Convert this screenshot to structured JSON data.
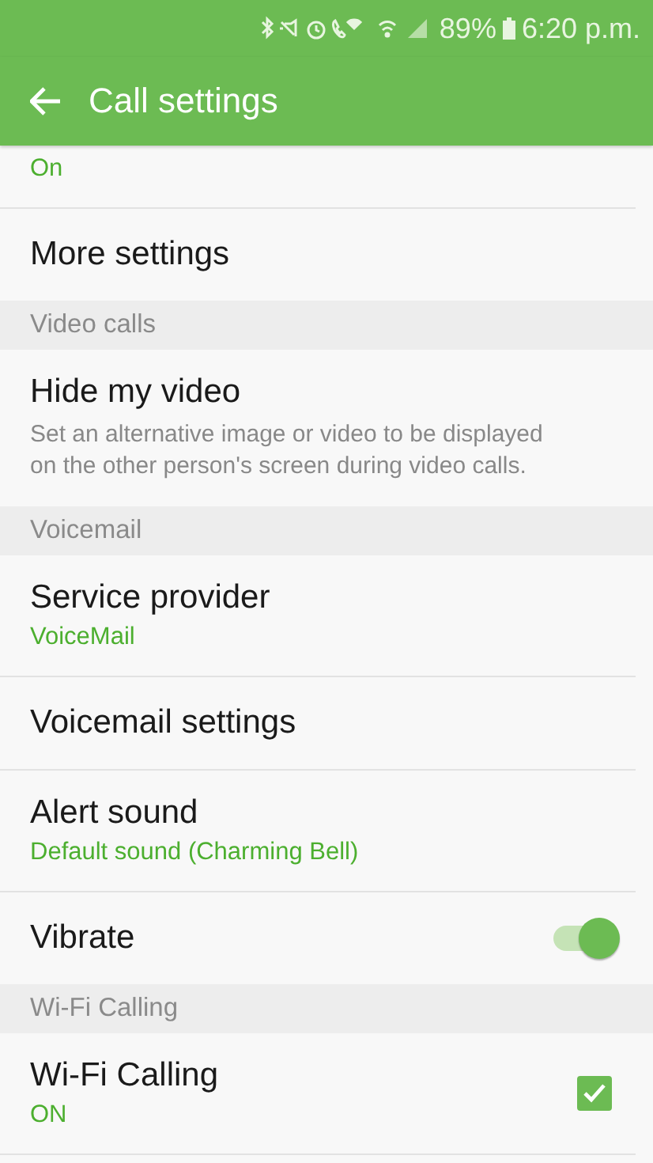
{
  "status_bar": {
    "battery_text": "89%",
    "time": "6:20 p.m."
  },
  "app_bar": {
    "title": "Call settings"
  },
  "list": [
    {
      "kind": "partial",
      "summary": "On"
    },
    {
      "kind": "item",
      "title": "More settings"
    },
    {
      "kind": "header",
      "title": "Video calls"
    },
    {
      "kind": "item",
      "title": "Hide my video",
      "description": "Set an alternative image or video to be displayed on the other person's screen during video calls."
    },
    {
      "kind": "header",
      "title": "Voicemail"
    },
    {
      "kind": "item",
      "title": "Service provider",
      "summary": "VoiceMail"
    },
    {
      "kind": "item",
      "title": "Voicemail settings"
    },
    {
      "kind": "item",
      "title": "Alert sound",
      "summary": "Default sound (Charming Bell)"
    },
    {
      "kind": "switch",
      "title": "Vibrate",
      "on": true
    },
    {
      "kind": "header",
      "title": "Wi-Fi Calling"
    },
    {
      "kind": "checkbox",
      "title": "Wi-Fi Calling",
      "summary": "ON",
      "checked": true
    }
  ]
}
